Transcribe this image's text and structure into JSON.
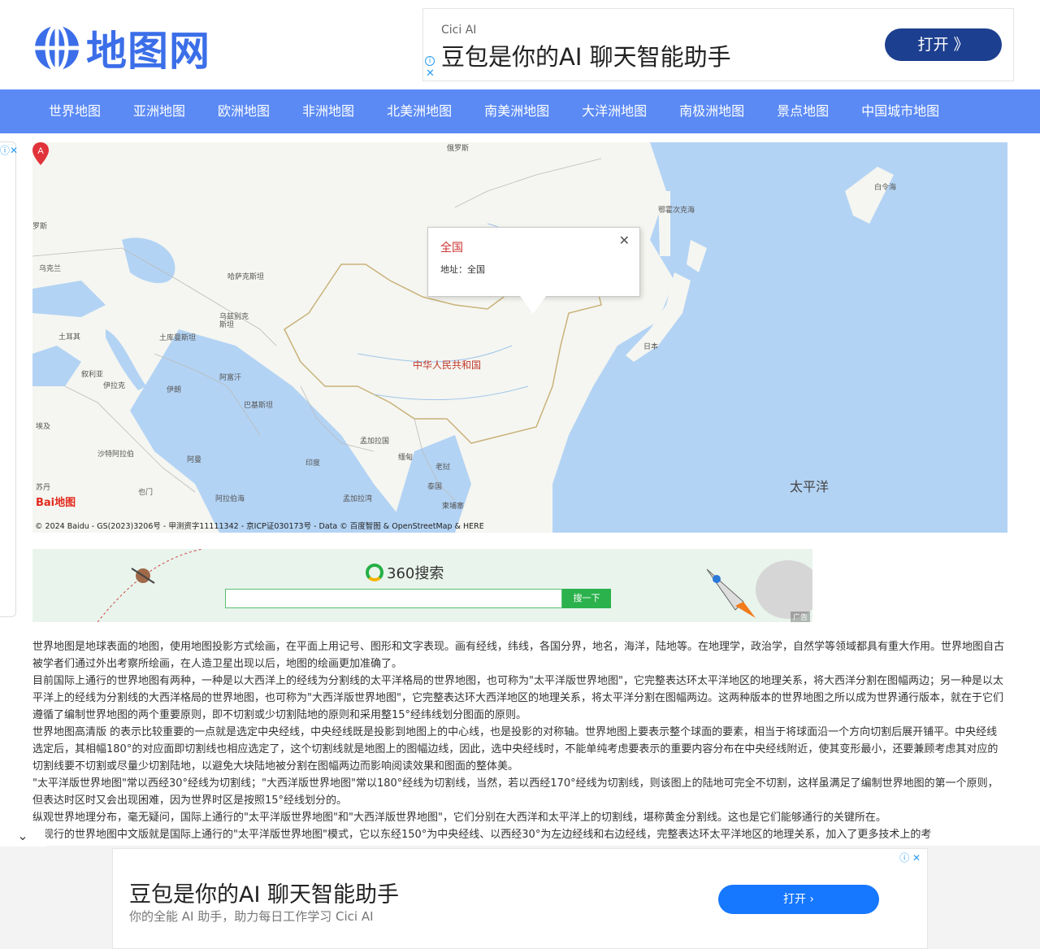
{
  "header": {
    "logo_text": "地图网",
    "top_ad": {
      "brand": "Cici AI",
      "title": "豆包是你的AI 聊天智能助手",
      "button": "打开 》"
    }
  },
  "nav": {
    "items": [
      "世界地图",
      "亚洲地图",
      "欧洲地图",
      "非洲地图",
      "北美洲地图",
      "南美洲地图",
      "大洋洲地图",
      "南极洲地图",
      "景点地图",
      "中国城市地图"
    ]
  },
  "map": {
    "popup": {
      "title": "全国",
      "address": "地址：全国"
    },
    "marker_letter": "A",
    "labels": {
      "russia": "俄罗斯",
      "okhotsk": "鄂霍次克海",
      "bering": "白令海",
      "ukraine": "乌克兰",
      "kazakhstan": "哈萨克斯坦",
      "uzbekistan": "乌兹别克\n斯坦",
      "turkmenistan": "土库曼斯坦",
      "turkey": "土耳其",
      "syria": "叙利亚",
      "iraq": "伊拉克",
      "iran": "伊朗",
      "afghanistan": "阿富汗",
      "pakistan": "巴基斯坦",
      "egypt": "埃及",
      "saudi": "沙特阿拉伯",
      "oman": "阿曼",
      "sudan": "苏丹",
      "yemen": "也门",
      "arabian_sea": "阿拉伯海",
      "india": "印度",
      "bangladesh": "孟加拉国",
      "myanmar": "缅甸",
      "laos": "老挝",
      "thailand": "泰国",
      "cambodia": "柬埔寨",
      "bay_bengal": "孟加拉湾",
      "china": "中华人民共和国",
      "japan": "日本",
      "pacific": "太平洋",
      "romania": "罗斯"
    },
    "copyright": "© 2024 Baidu - GS(2023)3206号 - 甲测资字11111342 - 京ICP证030173号 - Data © 百度智图 & OpenStreetMap & HERE",
    "baidu_logo": "Bai地图"
  },
  "search_banner": {
    "logo": "360搜索",
    "button": "搜一下",
    "ad_tag": "广告"
  },
  "article": {
    "paragraphs": [
      "世界地图是地球表面的地图，使用地图投影方式绘画，在平面上用记号、图形和文字表现。画有经线，纬线，各国分界，地名，海洋，陆地等。在地理学，政治学，自然学等领域都具有重大作用。世界地图自古被学者们通过外出考察所绘画，在人造卫星出现以后，地图的绘画更加准确了。",
      "目前国际上通行的世界地图有两种，一种是以大西洋上的经线为分割线的太平洋格局的世界地图，也可称为\"太平洋版世界地图\"，它完整表达环太平洋地区的地理关系，将大西洋分割在图幅两边；另一种是以太平洋上的经线为分割线的大西洋格局的世界地图，也可称为\"大西洋版世界地图\"，它完整表达环大西洋地区的地理关系，将太平洋分割在图幅两边。这两种版本的世界地图之所以成为世界通行版本，就在于它们遵循了编制世界地图的两个重要原则，即不切割或少切割陆地的原则和采用整15°经纬线划分图面的原则。",
      "世界地图高清版 的表示比较重要的一点就是选定中央经线，中央经线既是投影到地图上的中心线，也是投影的对称轴。世界地图上要表示整个球面的要素，相当于将球面沿一个方向切割后展开铺平。中央经线选定后，其相幅180°的对应面即切割线也相应选定了，这个切割线就是地图上的图幅边线，因此，选中央经线时，不能单纯考虑要表示的重要内容分布在中央经线附近，使其变形最小，还要兼顾考虑其对应的切割线要不切割或尽量少切割陆地，以避免大块陆地被分割在图幅两边而影响阅读效果和图面的整体美。",
      "\"太平洋版世界地图\"常以西经30°经线为切割线；\"大西洋版世界地图\"常以180°经线为切割线，当然，若以西经170°经线为切割线，则该图上的陆地可完全不切割，这样虽满足了编制世界地图的第一个原则，但表达时区时又会出现困难，因为世界时区是按照15°经线划分的。",
      "纵观世界地理分布，毫无疑问，国际上通行的\"太平洋版世界地图\"和\"大西洋版世界地图\"，它们分别在大西洋和太平洋上的切割线，堪称黄金分割线。这也是它们能够通行的关键所在。",
      "国现行的世界地图中文版就是国际上通行的\"太平洋版世界地图\"模式，它以东经150°为中央经线、以西经30°为左边经线和右边经线，完整表达环太平洋地区的地理关系，加入了更多技术上的考"
    ]
  },
  "bottom_ad": {
    "title": "豆包是你的AI 聊天智能助手",
    "subtitle": "你的全能 AI 助手，助力每日工作学习 Cici AI",
    "button": "打开 ›"
  },
  "icons": {
    "collapse": "chevron-down-icon",
    "ad_info": "info-icon",
    "ad_close": "close-icon"
  }
}
